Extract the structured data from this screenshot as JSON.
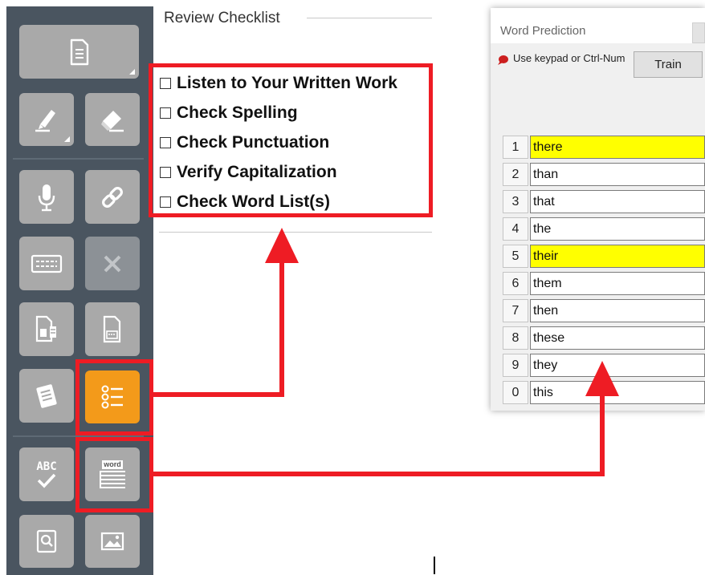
{
  "toolbar": {
    "buttons": [
      {
        "name": "document-button",
        "icon": "document-icon"
      },
      {
        "name": "highlighter-button",
        "icon": "highlighter-icon"
      },
      {
        "name": "eraser-button",
        "icon": "eraser-icon"
      },
      {
        "name": "microphone-button",
        "icon": "microphone-icon"
      },
      {
        "name": "link-button",
        "icon": "link-icon"
      },
      {
        "name": "keyboard-button",
        "icon": "keyboard-icon"
      },
      {
        "name": "close-button",
        "icon": "x-icon"
      },
      {
        "name": "document-export-button",
        "icon": "document-export-icon"
      },
      {
        "name": "document-card-button",
        "icon": "document-card-icon"
      },
      {
        "name": "notes-button",
        "icon": "notes-icon"
      },
      {
        "name": "review-checklist-button",
        "icon": "checklist-icon"
      },
      {
        "name": "spell-check-button",
        "icon": "abc-check-icon"
      },
      {
        "name": "word-prediction-button",
        "icon": "word-list-icon"
      },
      {
        "name": "dictionary-button",
        "icon": "search-book-icon"
      },
      {
        "name": "image-button",
        "icon": "image-icon"
      }
    ],
    "spell_check_text": "ABC",
    "word_icon_text": "word"
  },
  "review_checklist": {
    "title": "Review Checklist",
    "items": [
      "Listen to Your Written Work",
      "Check Spelling",
      "Check Punctuation",
      "Verify Capitalization",
      "Check Word List(s)"
    ]
  },
  "word_prediction": {
    "title": "Word Prediction",
    "hint": "Use keypad or Ctrl-Num",
    "train_label": "Train",
    "rows": [
      {
        "num": "1",
        "word": "there",
        "highlight": true
      },
      {
        "num": "2",
        "word": "than",
        "highlight": false
      },
      {
        "num": "3",
        "word": "that",
        "highlight": false
      },
      {
        "num": "4",
        "word": "the",
        "highlight": false
      },
      {
        "num": "5",
        "word": "their",
        "highlight": true
      },
      {
        "num": "6",
        "word": "them",
        "highlight": false
      },
      {
        "num": "7",
        "word": "then",
        "highlight": false
      },
      {
        "num": "8",
        "word": "these",
        "highlight": false
      },
      {
        "num": "9",
        "word": "they",
        "highlight": false
      },
      {
        "num": "0",
        "word": "this",
        "highlight": false
      }
    ]
  },
  "colors": {
    "annotation_red": "#ee1c24",
    "highlight_yellow": "#ffff00",
    "toolbar_bg": "#4a5560",
    "active_orange": "#f39a1a"
  }
}
